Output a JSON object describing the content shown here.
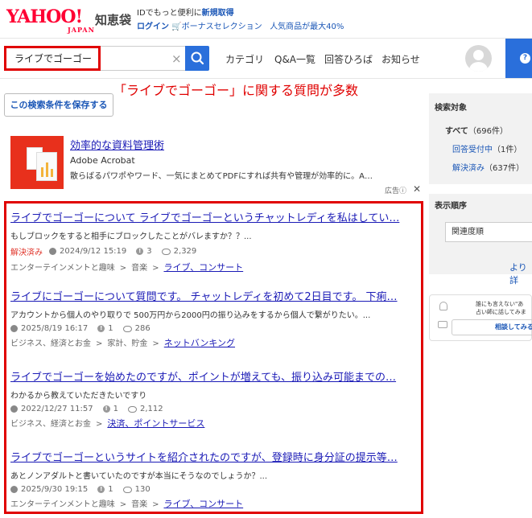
{
  "header": {
    "logo_text": "YAHOO!",
    "logo_sub": "JAPAN",
    "service_name": "知恵袋",
    "promo_line1_prefix": "IDでもっと便利に",
    "promo_line1_link": "新規取得",
    "promo_login": "ログイン",
    "promo_bonus": "ボーナスセレクション",
    "promo_popular": "人気商品が最大40%"
  },
  "search": {
    "query": "ライブでゴーゴー",
    "nav": [
      "カテゴリ",
      "Q&A一覧",
      "回答ひろば",
      "お知らせ"
    ]
  },
  "annotation": "「ライブでゴーゴー」に関する質問が多数",
  "save_button": "この検索条件を保存する",
  "ad": {
    "title": "効率的な資料管理術",
    "sponsor": "Adobe Acrobat",
    "description": "散らばるパワポやワード、一気にまとめてPDFにすれば共有や管理が効率的に。A…",
    "label": "広告"
  },
  "results": [
    {
      "title": "ライブでゴーゴーについて ライブでゴーゴーというチャットレディを私はしてい…",
      "snippet": "もしブロックをすると相手にブロックしたことがバレますか？？...",
      "solved": "解決済み",
      "date": "2024/9/12 15:19",
      "answers": "3",
      "views": "2,329",
      "category": [
        "エンターテインメントと趣味",
        "音楽"
      ],
      "category_link": "ライブ、コンサート"
    },
    {
      "title": "ライブにゴーゴーについて質問です。 チャットレディを初めて2日目です。 下痢…",
      "snippet": "アカウントから個人のやり取りで 500万円から2000円の振り込みをするから個人で繋がりたい。...",
      "solved": "",
      "date": "2025/8/19 16:17",
      "answers": "1",
      "views": "286",
      "category": [
        "ビジネス、経済とお金",
        "家計、貯金"
      ],
      "category_link": "ネットバンキング"
    },
    {
      "title": "ライブでゴーゴーを始めたのですが、ポイントが増えても、振り込み可能までの…",
      "snippet": "わかるから教えていただきたいですり",
      "solved": "",
      "date": "2022/12/27 11:57",
      "answers": "1",
      "views": "2,112",
      "category": [
        "ビジネス、経済とお金"
      ],
      "category_link": "決済、ポイントサービス"
    },
    {
      "title": "ライブでゴーゴーというサイトを紹介されたのですが、登録時に身分証の提示等…",
      "snippet": "あとノンアダルトと書いていたのですが本当にそうなのでしょうか？...",
      "solved": "",
      "date": "2025/9/30 19:15",
      "answers": "1",
      "views": "130",
      "category": [
        "エンターテインメントと趣味",
        "音楽"
      ],
      "category_link": "ライブ、コンサート"
    }
  ],
  "sidebar": {
    "target_heading": "検索対象",
    "all_label": "すべて",
    "all_count": "（696件）",
    "open_label": "回答受付中",
    "open_count": "（1件）",
    "solved_label": "解決済み",
    "solved_count": "（637件）",
    "sort_heading": "表示順序",
    "sort_value": "関連度順",
    "more": "より詳",
    "card_text_line1": "誰にも言えない\"あ",
    "card_text_line2": "占い師に話してみま",
    "card_button": "相談してみる"
  },
  "colors": {
    "accent_blue": "#2a6fdb",
    "link": "#1a1ab6",
    "highlight_red": "#e00000",
    "solved_red": "#e0352b"
  }
}
